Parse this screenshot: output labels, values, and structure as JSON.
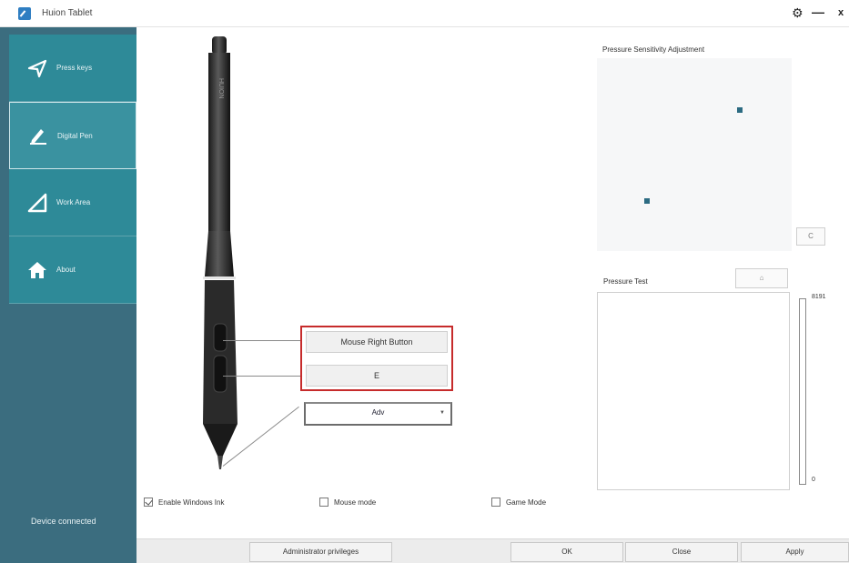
{
  "window": {
    "title": "Huion Tablet",
    "controls": {
      "settings": "⚙",
      "minimize": "—",
      "close": "x"
    }
  },
  "sidebar": {
    "items": [
      {
        "label": "Press keys",
        "icon": "paper-plane-icon",
        "active": false
      },
      {
        "label": "Digital Pen",
        "icon": "pen-icon",
        "active": true
      },
      {
        "label": "Work Area",
        "icon": "triangle-ruler-icon",
        "active": false
      },
      {
        "label": "About",
        "icon": "home-icon",
        "active": false
      }
    ],
    "status": "Device connected"
  },
  "pen": {
    "brand_text": "HUION",
    "upper_button_label": "Mouse Right Button",
    "lower_button_label": "E",
    "tip_select_value": "Adv"
  },
  "pressure_sensitivity": {
    "title": "Pressure Sensitivity Adjustment",
    "reset_label": "C"
  },
  "pressure_test": {
    "title": "Pressure Test",
    "clear_label": "⌂",
    "max_value": "8191",
    "min_value": "0"
  },
  "options": {
    "enable_windows_ink": {
      "label": "Enable Windows Ink",
      "checked": true
    },
    "mouse_mode": {
      "label": "Mouse mode",
      "checked": false
    },
    "game_mode": {
      "label": "Game Mode",
      "checked": false
    }
  },
  "footer": {
    "admin_label": "Administrator privileges",
    "ok_label": "OK",
    "close_label": "Close",
    "apply_label": "Apply"
  },
  "colors": {
    "sidebar_bg": "#3b6d7f",
    "sidebar_item": "#2e8a98",
    "accent_red": "#c62b2b",
    "curve_point": "#2c6b82"
  }
}
